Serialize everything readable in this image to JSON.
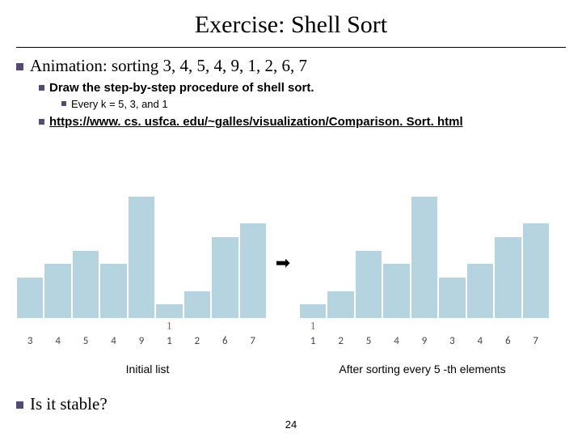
{
  "title": "Exercise: Shell Sort",
  "bullets": {
    "animation_label": "Animation: sorting 3, 4, 5, 4, 9, 1, 2, 6, 7",
    "draw_label": "Draw the step-by-step procedure of shell sort.",
    "every_k_label": "Every k = 5, 3, and 1",
    "link": "https://www. cs. usfca. edu/~galles/visualization/Comparison. Sort. html",
    "is_stable": "Is it stable?"
  },
  "arrow": "➡",
  "red_one": "1",
  "captions": {
    "initial": "Initial list",
    "after": "After sorting every 5 -th elements"
  },
  "page": "24",
  "chart_data": [
    {
      "type": "bar",
      "title": "Initial list",
      "categories": [
        "3",
        "4",
        "5",
        "4",
        "9",
        "1",
        "2",
        "6",
        "7"
      ],
      "values": [
        3,
        4,
        5,
        4,
        9,
        1,
        2,
        6,
        7
      ],
      "ylim": [
        0,
        9
      ],
      "xlabel": "",
      "ylabel": ""
    },
    {
      "type": "bar",
      "title": "After sorting every 5-th elements",
      "categories": [
        "1",
        "2",
        "5",
        "4",
        "9",
        "3",
        "4",
        "6",
        "7"
      ],
      "values": [
        1,
        2,
        5,
        4,
        9,
        3,
        4,
        6,
        7
      ],
      "ylim": [
        0,
        9
      ],
      "xlabel": "",
      "ylabel": ""
    }
  ]
}
